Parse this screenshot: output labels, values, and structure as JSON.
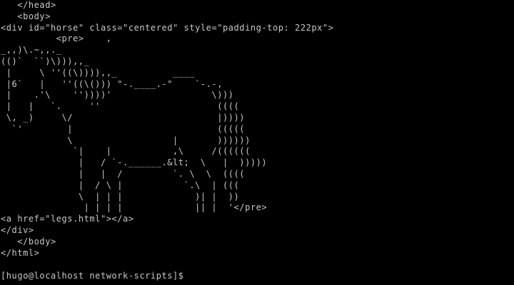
{
  "terminal": {
    "lines": [
      "   </head>",
      "   <body>",
      "<div id=\"horse\" class=\"centered\" style=\"padding-top: 222px\">",
      "          <pre>    ,",
      "_,,)\\.~,,._",
      "(()`  ``)\\))),,_",
      " |     \\ ''((\\)))),,_          ____",
      " |6`   |   ''((\\())) \"-.____.-\"    `-.-,",
      " |    .'\\    ''))))'                  \\)))",
      " |   |   `.     ''                     ((((",
      " \\, _)     \\/                          |))))",
      "  `'        |                          (((((",
      "            \\                  |       ))))))",
      "             `|    |           ,\\     /((((((",
      "              |   / `-.______.&lt;  \\   |  )))))",
      "              |   |  /         `. \\  \\  ((((",
      "              |  / \\ |           `.\\  | (((",
      "              \\  | | |             )| |  ))",
      "               | | | |             || |  '</pre>",
      "<a href=\"legs.html\"></a>",
      "</div>",
      "   </body>",
      "</html>"
    ],
    "prompt": "[hugo@localhost network-scripts]$ "
  }
}
